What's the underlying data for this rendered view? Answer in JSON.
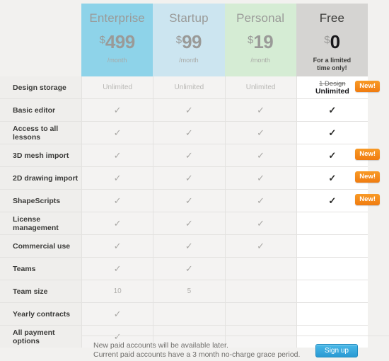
{
  "plans": [
    {
      "name": "Enterprise",
      "currency": "$",
      "amount": "499",
      "period": "/month",
      "note": "",
      "color": "#8ed3e9"
    },
    {
      "name": "Startup",
      "currency": "$",
      "amount": "99",
      "period": "/month",
      "note": "",
      "color": "#cce5f0"
    },
    {
      "name": "Personal",
      "currency": "$",
      "amount": "19",
      "period": "/month",
      "note": "",
      "color": "#d5ecd4"
    },
    {
      "name": "Free",
      "currency": "$",
      "amount": "0",
      "period": "",
      "note": "For a limited\ntime only!",
      "note_line1": "For a limited",
      "note_line2": "time only!",
      "color": "#d5d4d2"
    }
  ],
  "rows": [
    {
      "label": "Design storage",
      "cells": [
        "Unlimited",
        "Unlimited",
        "Unlimited",
        "storage-upgrade"
      ],
      "free_old": "1 Design",
      "free_new": "Unlimited",
      "badge": "New!"
    },
    {
      "label": "Basic editor",
      "cells": [
        "check",
        "check",
        "check",
        "check"
      ],
      "badge": ""
    },
    {
      "label": "Access to all lessons",
      "cells": [
        "check",
        "check",
        "check",
        "check"
      ],
      "badge": ""
    },
    {
      "label": "3D mesh import",
      "cells": [
        "check",
        "check",
        "check",
        "check"
      ],
      "badge": "New!"
    },
    {
      "label": "2D drawing import",
      "cells": [
        "check",
        "check",
        "check",
        "check"
      ],
      "badge": "New!"
    },
    {
      "label": "ShapeScripts",
      "cells": [
        "check",
        "check",
        "check",
        "check"
      ],
      "badge": "New!"
    },
    {
      "label": "License management",
      "cells": [
        "check",
        "check",
        "check",
        ""
      ],
      "badge": ""
    },
    {
      "label": "Commercial use",
      "cells": [
        "check",
        "check",
        "check",
        ""
      ],
      "badge": ""
    },
    {
      "label": "Teams",
      "cells": [
        "check",
        "check",
        "",
        ""
      ],
      "badge": ""
    },
    {
      "label": "Team size",
      "cells": [
        "10",
        "5",
        "",
        ""
      ],
      "badge": ""
    },
    {
      "label": "Yearly contracts",
      "cells": [
        "check",
        "",
        "",
        ""
      ],
      "badge": ""
    },
    {
      "label": "All payment options",
      "cells": [
        "check",
        "",
        "",
        ""
      ],
      "badge": ""
    }
  ],
  "footer": {
    "line1": "New paid accounts will be available later.",
    "line2": "Current paid accounts have a 3 month no-charge grace period.",
    "signup_label": "Sign up",
    "signup_color": "#2a9ad3"
  },
  "icons": {
    "check": "✓"
  },
  "badge_color": "#f5901e"
}
